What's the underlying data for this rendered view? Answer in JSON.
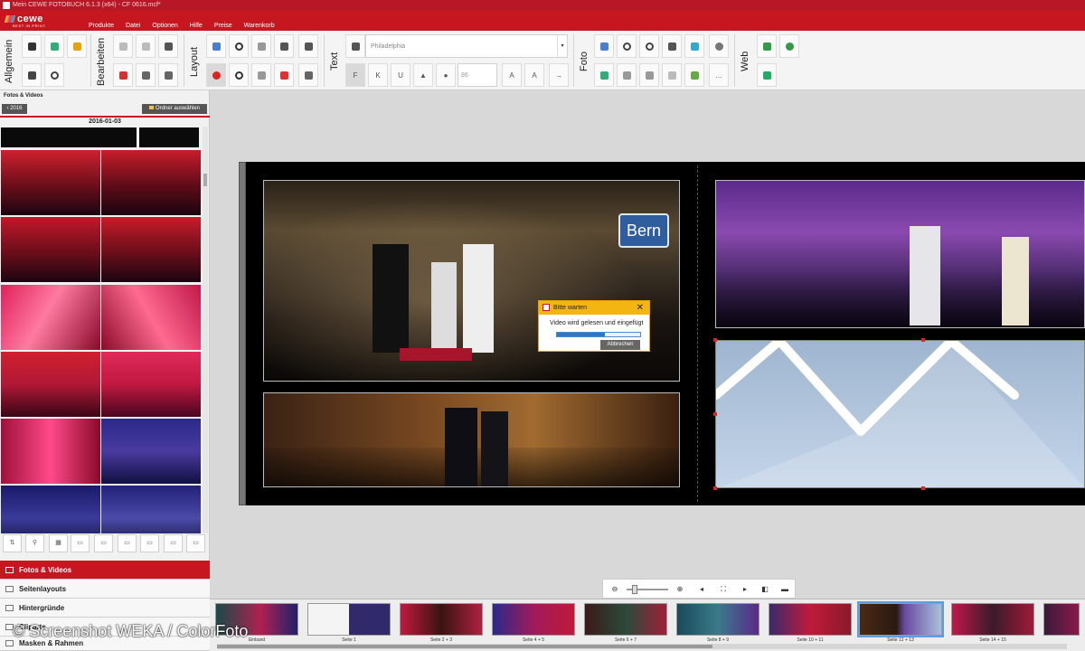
{
  "window": {
    "title": "Mein CEWE FOTOBUCH 6.1.3 (x64) - CF 0616.mcf*"
  },
  "brand": {
    "name": "cewe",
    "tagline": "BEST IN PRINT."
  },
  "menu": [
    "Produkte",
    "Datei",
    "Optionen",
    "Hilfe",
    "Preise",
    "Warenkorb"
  ],
  "ribbon": {
    "groups": [
      "Allgemein",
      "Bearbeiten",
      "Layout",
      "Text",
      "Foto",
      "Web"
    ],
    "font_value": "Philadelphia",
    "size_value": "86"
  },
  "left_panel": {
    "title": "Fotos & Videos",
    "back_label": "2016",
    "folder_label": "Ordner auswählen",
    "date": "2016-01-03"
  },
  "accordion": [
    "Fotos & Videos",
    "Seitenlayouts",
    "Hintergründe",
    "Cliparts",
    "Masken & Rahmen"
  ],
  "dialog": {
    "title": "Bitte warten",
    "message": "Video wird gelesen und eingefügt",
    "progress": 0.58,
    "cancel": "Abbrechen"
  },
  "photo_sign": "Bern",
  "filmstrip": {
    "pages": [
      "Einband",
      "Seite 1",
      "Seite 2 + 3",
      "Seite 4 + 5",
      "Seite 6 + 7",
      "Seite 8 + 9",
      "Seite 10 + 11",
      "Seite 12 + 13",
      "Seite 14 + 15"
    ],
    "selected": "Seite 12 + 13"
  },
  "watermark": "© Screenshot WEKA / ColorFoto",
  "colors": {
    "brand_red": "#c6161f",
    "dialog_yellow": "#f3b512",
    "progress_blue": "#2f78c8"
  }
}
